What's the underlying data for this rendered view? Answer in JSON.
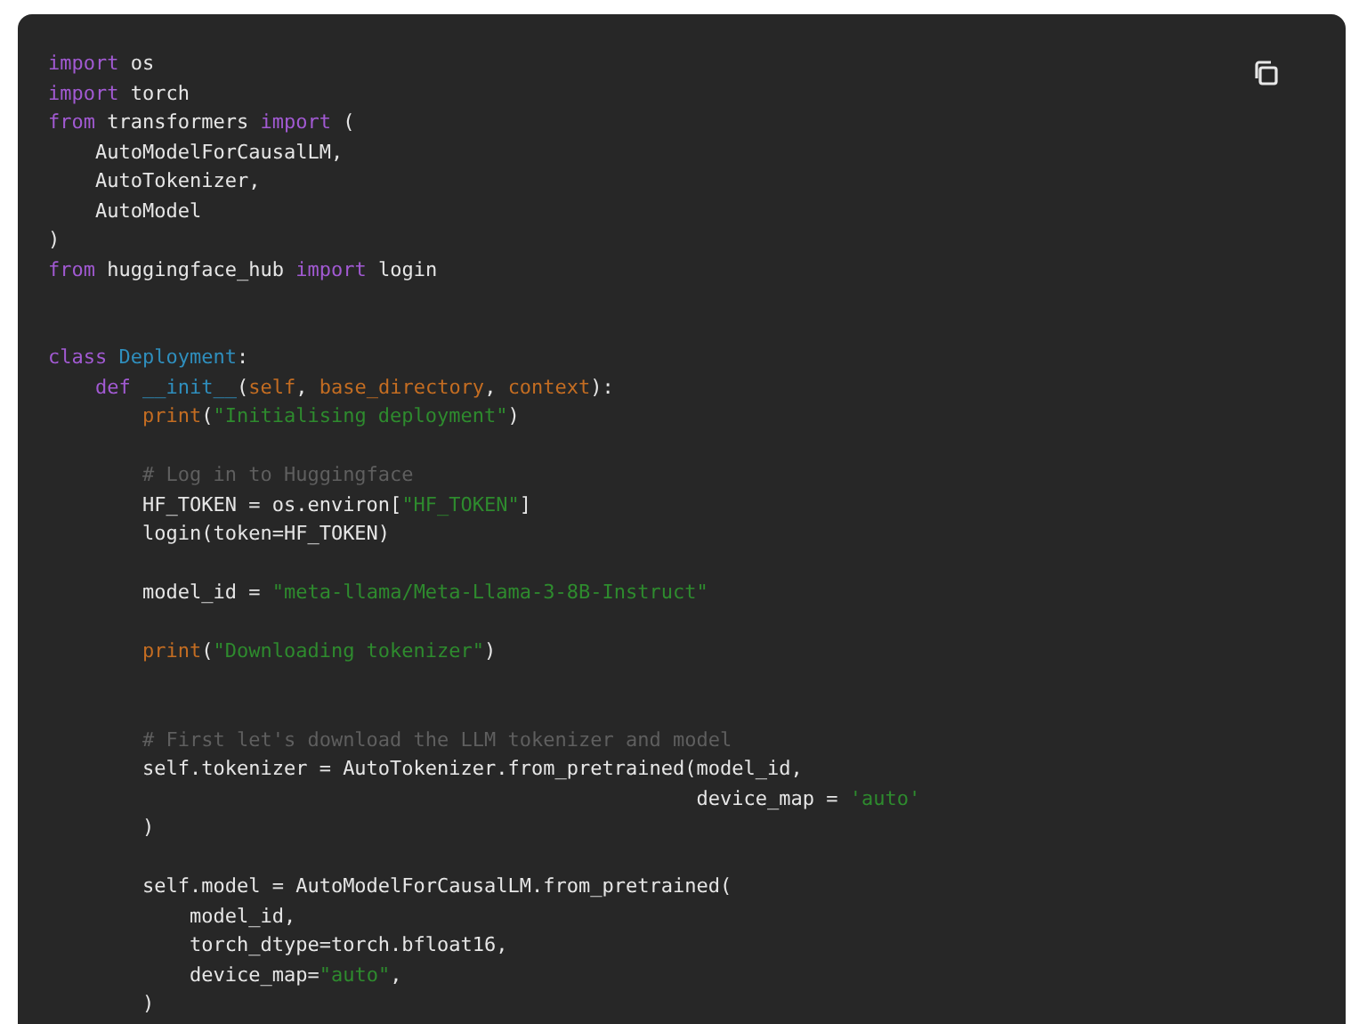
{
  "code_block": {
    "copy_button": {
      "kind": "copy"
    },
    "lines": [
      {
        "kind": "code",
        "tokens": [
          {
            "kind": "keyword",
            "text": "import"
          },
          {
            "kind": "plain",
            "text": " os"
          }
        ]
      },
      {
        "kind": "code",
        "tokens": [
          {
            "kind": "keyword",
            "text": "import"
          },
          {
            "kind": "plain",
            "text": " torch"
          }
        ]
      },
      {
        "kind": "code",
        "tokens": [
          {
            "kind": "keyword",
            "text": "from"
          },
          {
            "kind": "plain",
            "text": " transformers "
          },
          {
            "kind": "keyword",
            "text": "import"
          },
          {
            "kind": "plain",
            "text": " ("
          }
        ]
      },
      {
        "kind": "code",
        "tokens": [
          {
            "kind": "plain",
            "text": "    AutoModelForCausalLM,"
          }
        ]
      },
      {
        "kind": "code",
        "tokens": [
          {
            "kind": "plain",
            "text": "    AutoTokenizer,"
          }
        ]
      },
      {
        "kind": "code",
        "tokens": [
          {
            "kind": "plain",
            "text": "    AutoModel"
          }
        ]
      },
      {
        "kind": "code",
        "tokens": [
          {
            "kind": "plain",
            "text": ")"
          }
        ]
      },
      {
        "kind": "code",
        "tokens": [
          {
            "kind": "keyword",
            "text": "from"
          },
          {
            "kind": "plain",
            "text": " huggingface_hub "
          },
          {
            "kind": "keyword",
            "text": "import"
          },
          {
            "kind": "plain",
            "text": " login"
          }
        ]
      },
      {
        "kind": "blank"
      },
      {
        "kind": "blank"
      },
      {
        "kind": "code",
        "tokens": [
          {
            "kind": "keyword",
            "text": "class"
          },
          {
            "kind": "name",
            "text": " Deployment"
          },
          {
            "kind": "plain",
            "text": ":"
          }
        ]
      },
      {
        "kind": "code",
        "tokens": [
          {
            "kind": "keyword",
            "text": "    def"
          },
          {
            "kind": "name",
            "text": " __init__"
          },
          {
            "kind": "plain",
            "text": "("
          },
          {
            "kind": "param",
            "text": "self"
          },
          {
            "kind": "plain",
            "text": ", "
          },
          {
            "kind": "param",
            "text": "base_directory"
          },
          {
            "kind": "plain",
            "text": ", "
          },
          {
            "kind": "param",
            "text": "context"
          },
          {
            "kind": "plain",
            "text": "):"
          }
        ]
      },
      {
        "kind": "code",
        "tokens": [
          {
            "kind": "param",
            "text": "        print"
          },
          {
            "kind": "plain",
            "text": "("
          },
          {
            "kind": "string",
            "text": "\"Initialising deployment\""
          },
          {
            "kind": "plain",
            "text": ")"
          }
        ]
      },
      {
        "kind": "blank"
      },
      {
        "kind": "code",
        "tokens": [
          {
            "kind": "comment",
            "text": "        # Log in to Huggingface"
          }
        ]
      },
      {
        "kind": "code",
        "tokens": [
          {
            "kind": "plain",
            "text": "        HF_TOKEN = os.environ["
          },
          {
            "kind": "string",
            "text": "\"HF_TOKEN\""
          },
          {
            "kind": "plain",
            "text": "]"
          }
        ]
      },
      {
        "kind": "code",
        "tokens": [
          {
            "kind": "plain",
            "text": "        login(token=HF_TOKEN)"
          }
        ]
      },
      {
        "kind": "blank"
      },
      {
        "kind": "code",
        "tokens": [
          {
            "kind": "plain",
            "text": "        model_id = "
          },
          {
            "kind": "string",
            "text": "\"meta-llama/Meta-Llama-3-8B-Instruct\""
          }
        ]
      },
      {
        "kind": "blank"
      },
      {
        "kind": "code",
        "tokens": [
          {
            "kind": "param",
            "text": "        print"
          },
          {
            "kind": "plain",
            "text": "("
          },
          {
            "kind": "string",
            "text": "\"Downloading tokenizer\""
          },
          {
            "kind": "plain",
            "text": ")"
          }
        ]
      },
      {
        "kind": "blank"
      },
      {
        "kind": "blank"
      },
      {
        "kind": "code",
        "tokens": [
          {
            "kind": "comment",
            "text": "        # First let's download the LLM tokenizer and model"
          }
        ]
      },
      {
        "kind": "code",
        "tokens": [
          {
            "kind": "plain",
            "text": "        self.tokenizer = AutoTokenizer.from_pretrained(model_id,"
          }
        ]
      },
      {
        "kind": "code",
        "tokens": [
          {
            "kind": "plain",
            "text": "                                                       device_map = "
          },
          {
            "kind": "string",
            "text": "'auto'"
          }
        ]
      },
      {
        "kind": "code",
        "tokens": [
          {
            "kind": "plain",
            "text": "        )"
          }
        ]
      },
      {
        "kind": "blank"
      },
      {
        "kind": "code",
        "tokens": [
          {
            "kind": "plain",
            "text": "        self.model = AutoModelForCausalLM.from_pretrained("
          }
        ]
      },
      {
        "kind": "code",
        "tokens": [
          {
            "kind": "plain",
            "text": "            model_id,"
          }
        ]
      },
      {
        "kind": "code",
        "tokens": [
          {
            "kind": "plain",
            "text": "            torch_dtype=torch.bfloat16,"
          }
        ]
      },
      {
        "kind": "code",
        "tokens": [
          {
            "kind": "plain",
            "text": "            device_map="
          },
          {
            "kind": "string",
            "text": "\"auto\""
          },
          {
            "kind": "plain",
            "text": ","
          }
        ]
      },
      {
        "kind": "code",
        "tokens": [
          {
            "kind": "plain",
            "text": "        )"
          }
        ]
      }
    ]
  }
}
